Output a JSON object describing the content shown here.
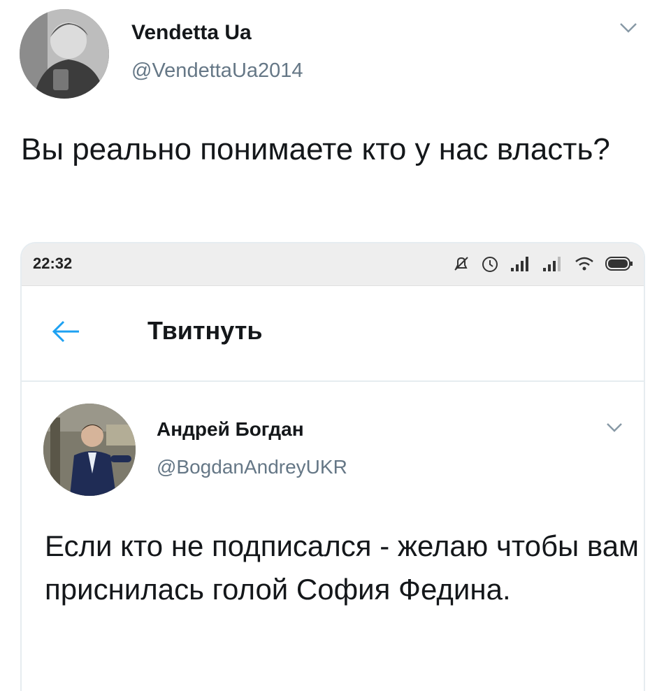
{
  "outer_tweet": {
    "display_name": "Vendetta Ua",
    "handle": "@VendettaUa2014",
    "text": "Вы реально понимаете кто у нас власть?"
  },
  "screenshot": {
    "status_bar": {
      "time": "22:32",
      "icons": [
        "notifications-off-icon",
        "alarm-icon",
        "signal-icon",
        "signal-icon",
        "wifi-icon",
        "battery-icon"
      ]
    },
    "header": {
      "title": "Твитнуть"
    },
    "tweet": {
      "display_name": "Андрей Богдан",
      "handle": "@BogdanAndreyUKR",
      "text": "Если кто не подписался - желаю чтобы вам приснилась голой София Федина."
    }
  },
  "colors": {
    "text": "#14171a",
    "secondary": "#657786",
    "accent": "#1da1f2"
  }
}
